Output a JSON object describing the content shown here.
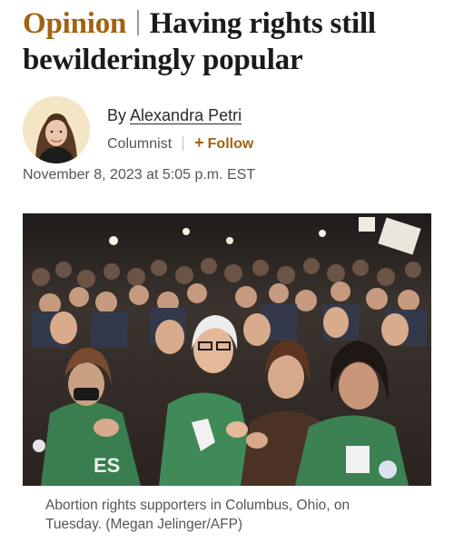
{
  "article": {
    "kicker": "Opinion",
    "title": "Having rights still bewilderingly popular",
    "byline_prefix": "By",
    "author": "Alexandra Petri",
    "role": "Columnist",
    "follow_label": "Follow",
    "date": "November 8, 2023 at 5:05 p.m. EST"
  },
  "photo": {
    "caption": "Abortion rights supporters in Columbus, Ohio, on Tuesday. (Megan Jelinger/AFP)"
  },
  "colors": {
    "kicker": "#a2620f",
    "follow": "#a2620f",
    "text": "#1a1a1a",
    "muted": "#555555"
  },
  "icons": {
    "follow": "plus-icon"
  }
}
